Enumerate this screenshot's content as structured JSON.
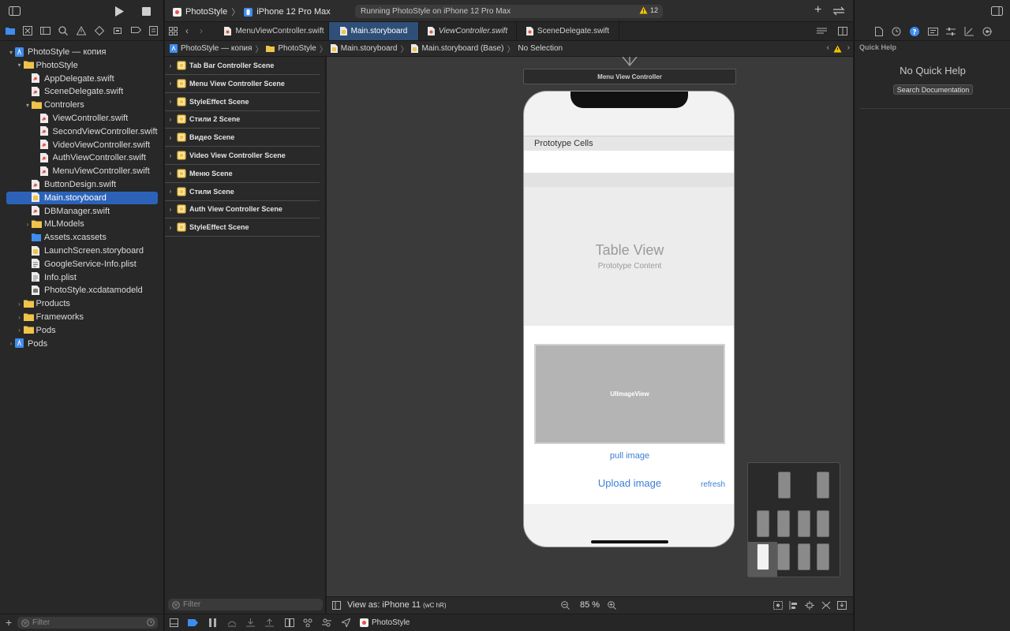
{
  "toolbar": {
    "scheme_target": "PhotoStyle",
    "device": "iPhone 12 Pro Max",
    "activity_text": "Running PhotoStyle on iPhone 12 Pro Max",
    "warning_count": "12"
  },
  "tabs": [
    {
      "label": "MenuViewController.swift"
    },
    {
      "label": "Main.storyboard"
    },
    {
      "label": "ViewController.swift"
    },
    {
      "label": "SceneDelegate.swift"
    }
  ],
  "jump_bar": {
    "items": [
      "PhotoStyle — копия",
      "PhotoStyle",
      "Main.storyboard",
      "Main.storyboard (Base)",
      "No Selection"
    ]
  },
  "navigator": {
    "items": [
      {
        "label": "PhotoStyle — копия"
      },
      {
        "label": "PhotoStyle"
      },
      {
        "label": "AppDelegate.swift"
      },
      {
        "label": "SceneDelegate.swift"
      },
      {
        "label": "Controlers"
      },
      {
        "label": "ViewController.swift"
      },
      {
        "label": "SecondViewController.swift"
      },
      {
        "label": "VideoViewController.swift"
      },
      {
        "label": "AuthViewController.swift"
      },
      {
        "label": "MenuViewController.swift"
      },
      {
        "label": "ButtonDesign.swift"
      },
      {
        "label": "Main.storyboard"
      },
      {
        "label": "DBManager.swift"
      },
      {
        "label": "MLModels"
      },
      {
        "label": "Assets.xcassets"
      },
      {
        "label": "LaunchScreen.storyboard"
      },
      {
        "label": "GoogleService-Info.plist"
      },
      {
        "label": "Info.plist"
      },
      {
        "label": "PhotoStyle.xcdatamodeld"
      },
      {
        "label": "Products"
      },
      {
        "label": "Frameworks"
      },
      {
        "label": "Pods"
      },
      {
        "label": "Pods"
      }
    ],
    "filter_placeholder": "Filter"
  },
  "outline": {
    "scenes": [
      {
        "label": "Tab Bar Controller Scene"
      },
      {
        "label": "Menu View Controller Scene"
      },
      {
        "label": "StyleEffect Scene"
      },
      {
        "label": "Стили 2 Scene"
      },
      {
        "label": "Видео Scene"
      },
      {
        "label": "Video View Controller Scene"
      },
      {
        "label": "Меню Scene"
      },
      {
        "label": "Стили Scene"
      },
      {
        "label": "Auth View Controller Scene"
      },
      {
        "label": "StyleEffect Scene"
      }
    ],
    "filter_placeholder": "Filter"
  },
  "canvas": {
    "vc_title": "Menu View Controller",
    "prototype_cells": "Prototype Cells",
    "table_view_title": "Table View",
    "table_view_subtitle": "Prototype Content",
    "image_view_label": "UIImageView",
    "pull_image": "pull image",
    "upload_image": "Upload image",
    "refresh": "refresh"
  },
  "canvas_bar": {
    "view_as": "View as: iPhone 11",
    "size_class": "(wC hR)",
    "zoom": "85 %"
  },
  "debug_bar": {
    "target": "PhotoStyle"
  },
  "inspector": {
    "title": "Quick Help",
    "no_help": "No Quick Help",
    "search_docs": "Search Documentation"
  },
  "colors": {
    "accent": "#2c63b9",
    "link": "#3a7fd6",
    "warning": "#f5c400",
    "swift": "#e8543f",
    "folder": "#f0c44a"
  }
}
